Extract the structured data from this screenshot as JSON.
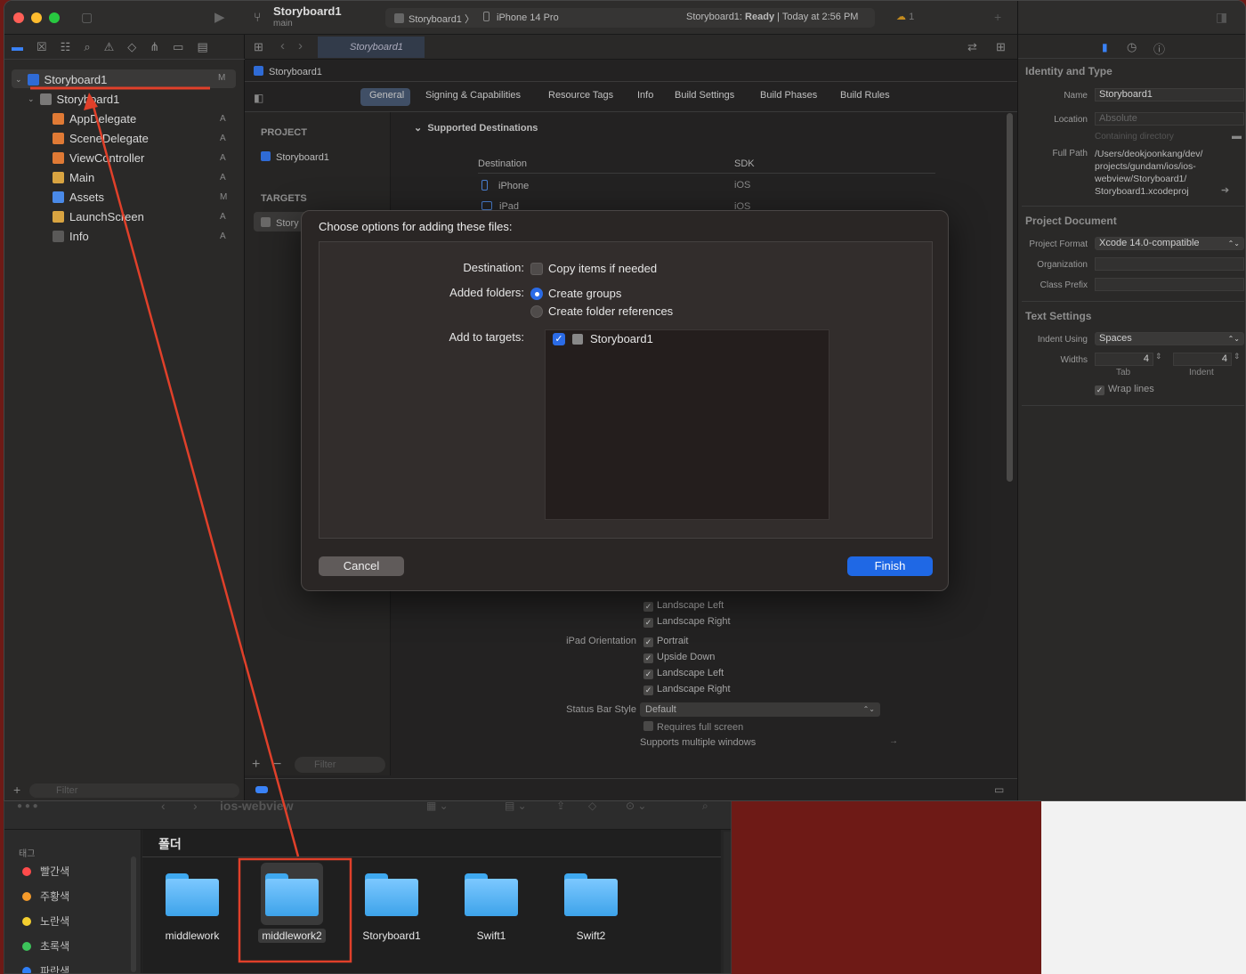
{
  "xcode": {
    "project_title": "Storyboard1",
    "branch": "main",
    "scheme": "Storyboard1",
    "device": "iPhone 14 Pro",
    "status_prefix": "Storyboard1:",
    "status_ready": "Ready",
    "status_time": "| Today at 2:56 PM",
    "warnings_count": "1",
    "tab_title": "Storyboard1",
    "jump_bar": "Storyboard1",
    "navigator": {
      "root": {
        "label": "Storyboard1",
        "badge": "M"
      },
      "group": {
        "label": "Storyboard1"
      },
      "files": [
        {
          "label": "AppDelegate",
          "badge": "A",
          "icon": "swift-file-icon"
        },
        {
          "label": "SceneDelegate",
          "badge": "A",
          "icon": "swift-file-icon"
        },
        {
          "label": "ViewController",
          "badge": "A",
          "icon": "swift-file-icon"
        },
        {
          "label": "Main",
          "badge": "A",
          "icon": "storyboard-icon"
        },
        {
          "label": "Assets",
          "badge": "M",
          "icon": "assets-icon"
        },
        {
          "label": "LaunchScreen",
          "badge": "A",
          "icon": "storyboard-icon"
        },
        {
          "label": "Info",
          "badge": "A",
          "icon": "plist-icon"
        }
      ],
      "filter_placeholder": "Filter"
    },
    "editor": {
      "tabs": [
        "General",
        "Signing & Capabilities",
        "Resource Tags",
        "Info",
        "Build Settings",
        "Build Phases",
        "Build Rules"
      ],
      "project_header": "PROJECT",
      "project_item": "Storyboard1",
      "targets_header": "TARGETS",
      "target_item": "Story",
      "section_title": "Supported Destinations",
      "dest_col": "Destination",
      "sdk_col": "SDK",
      "rows": [
        {
          "dest": "iPhone",
          "sdk": "iOS"
        },
        {
          "dest": "iPad",
          "sdk": "iOS"
        }
      ],
      "iphone_orient": [
        "Landscape Left",
        "Landscape Right"
      ],
      "ipad_label": "iPad Orientation",
      "ipad_orient": [
        "Portrait",
        "Upside Down",
        "Landscape Left",
        "Landscape Right"
      ],
      "status_bar_label": "Status Bar Style",
      "status_bar_value": "Default",
      "requires_full": "Requires full screen",
      "multi_windows": "Supports multiple windows",
      "filter_placeholder": "Filter"
    },
    "inspector": {
      "identity_title": "Identity and Type",
      "name_label": "Name",
      "name_value": "Storyboard1",
      "location_label": "Location",
      "location_value": "Absolute",
      "containing": "Containing directory",
      "full_path_label": "Full Path",
      "full_path_lines": [
        "/Users/deokjoonkang/dev/",
        "projects/gundam/ios/ios-",
        "webview/Storyboard1/",
        "Storyboard1.xcodeproj"
      ],
      "project_doc_title": "Project Document",
      "project_format_label": "Project Format",
      "project_format_value": "Xcode 14.0-compatible",
      "organization_label": "Organization",
      "class_prefix_label": "Class Prefix",
      "text_settings_title": "Text Settings",
      "indent_using_label": "Indent Using",
      "indent_using_value": "Spaces",
      "widths_label": "Widths",
      "tab_value": "4",
      "indent_value": "4",
      "tab_label": "Tab",
      "indent_label": "Indent",
      "wrap_lines": "Wrap lines"
    }
  },
  "dialog": {
    "title": "Choose options for adding these files:",
    "destination_label": "Destination:",
    "copy_items": "Copy items if needed",
    "added_folders_label": "Added folders:",
    "create_groups": "Create groups",
    "create_refs": "Create folder references",
    "add_targets_label": "Add to targets:",
    "target_name": "Storyboard1",
    "cancel": "Cancel",
    "finish": "Finish"
  },
  "finder": {
    "path_title": "ios-webview",
    "section": "폴더",
    "tags_header": "태그",
    "tags": [
      {
        "label": "빨간색",
        "color": "#ff4b4b"
      },
      {
        "label": "주황색",
        "color": "#f59b2b"
      },
      {
        "label": "노란색",
        "color": "#f4cf2f"
      },
      {
        "label": "초록색",
        "color": "#3cc45a"
      },
      {
        "label": "파란색",
        "color": "#2f7ff7"
      }
    ],
    "folders": [
      "middlework",
      "middlework2",
      "Storyboard1",
      "Swift1",
      "Swift2"
    ],
    "selected_folder": "middlework2"
  },
  "annotation_color": "#e0402a"
}
